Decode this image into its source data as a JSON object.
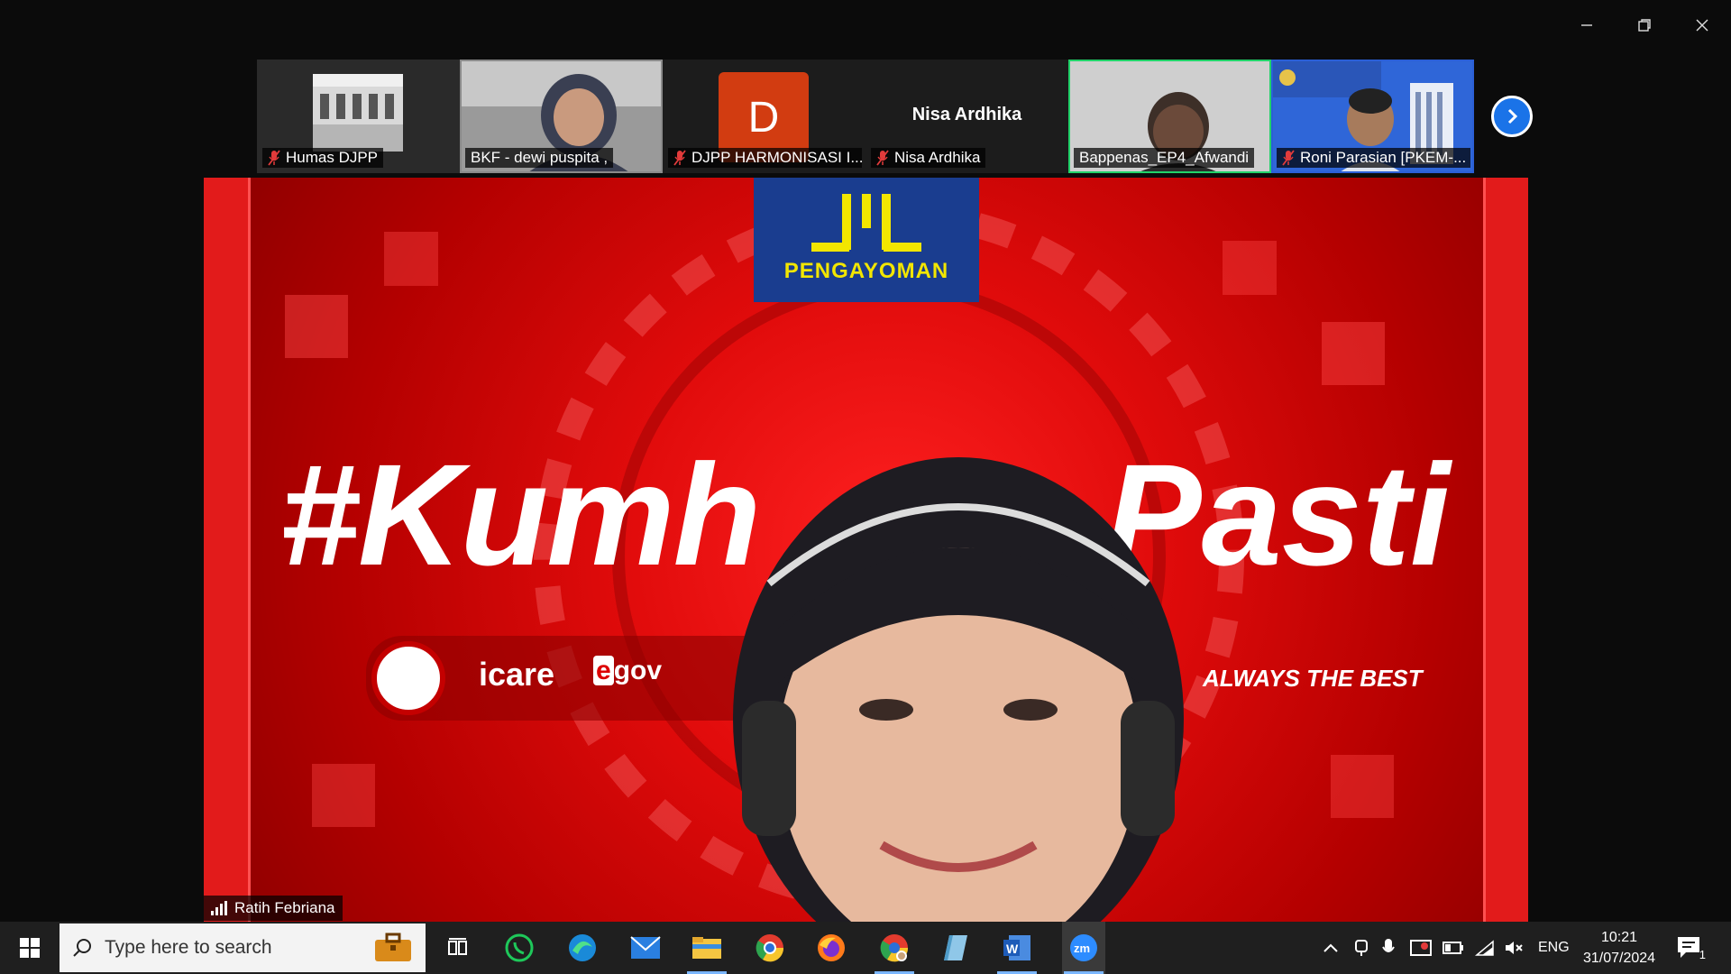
{
  "window": {
    "controls": [
      "minimize",
      "restore",
      "close"
    ]
  },
  "participants": [
    {
      "name": "Humas DJPP",
      "muted": true,
      "type": "image"
    },
    {
      "name": "BKF - dewi puspita ,",
      "muted": false,
      "type": "video"
    },
    {
      "name": "DJPP HARMONISASI I...",
      "muted": true,
      "type": "avatar",
      "avatar_letter": "D",
      "avatar_color": "#d23c11"
    },
    {
      "name": "Nisa Ardhika",
      "muted": true,
      "type": "name",
      "center_name": "Nisa Ardhika"
    },
    {
      "name": "Bappenas_EP4_Afwandi",
      "muted": false,
      "type": "video",
      "active": true
    },
    {
      "name": "Roni Parasian [PKEM-...",
      "muted": true,
      "type": "video"
    }
  ],
  "main_video": {
    "logo_text": "PENGAYOMAN",
    "hashtag_left": "#Kumh",
    "hashtag_right": "Pasti",
    "brand_icare": "icare",
    "brand_egov_e": "e",
    "brand_egov_rest": "gov",
    "always": "ALWAYS THE BEST",
    "speaker_name": "Ratih Febriana"
  },
  "taskbar": {
    "search_placeholder": "Type here to search",
    "apps": [
      "task-view",
      "whatsapp",
      "edge",
      "mail",
      "file-explorer",
      "chrome",
      "firefox",
      "chrome-profile",
      "notes-app",
      "word",
      "zoom"
    ],
    "active_app": "zoom",
    "tray_language": "ENG",
    "time": "10:21",
    "date": "31/07/2024",
    "notification_count": "1"
  },
  "colors": {
    "active_border": "#22d36a",
    "next_button": "#1a73e8",
    "slide_red": "#d20a0a",
    "logo_blue": "#1a3d8f",
    "logo_yellow": "#f2e600"
  }
}
